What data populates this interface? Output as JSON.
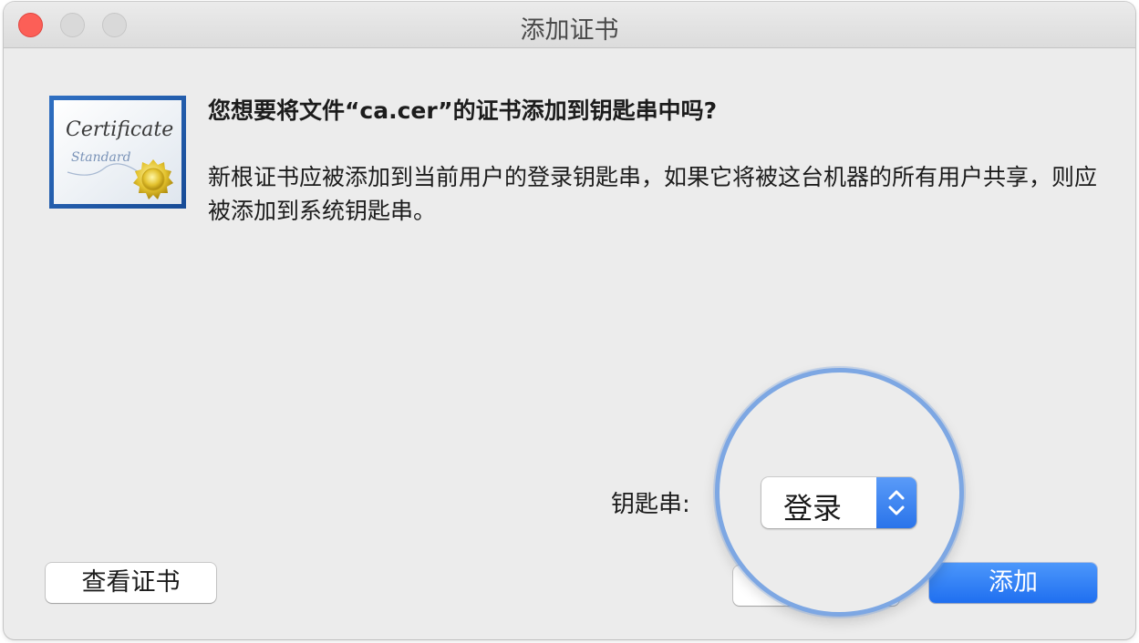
{
  "window": {
    "title": "添加证书"
  },
  "icon": {
    "name": "certificate-icon",
    "line1": "Certificate",
    "line2": "Standard"
  },
  "message": {
    "heading": "您想要将文件“ca.cer”的证书添加到钥匙串中吗?",
    "body": "新根证书应被添加到当前用户的登录钥匙串，如果它将被这台机器的所有用户共享，则应被添加到系统钥匙串。"
  },
  "keychain": {
    "label": "钥匙串:",
    "selected": "登录"
  },
  "buttons": {
    "view_certificate": "查看证书",
    "add": "添加"
  },
  "colors": {
    "accent": "#2a74ea",
    "close": "#fc5f57",
    "magnifier_ring": "#7da7e3"
  }
}
